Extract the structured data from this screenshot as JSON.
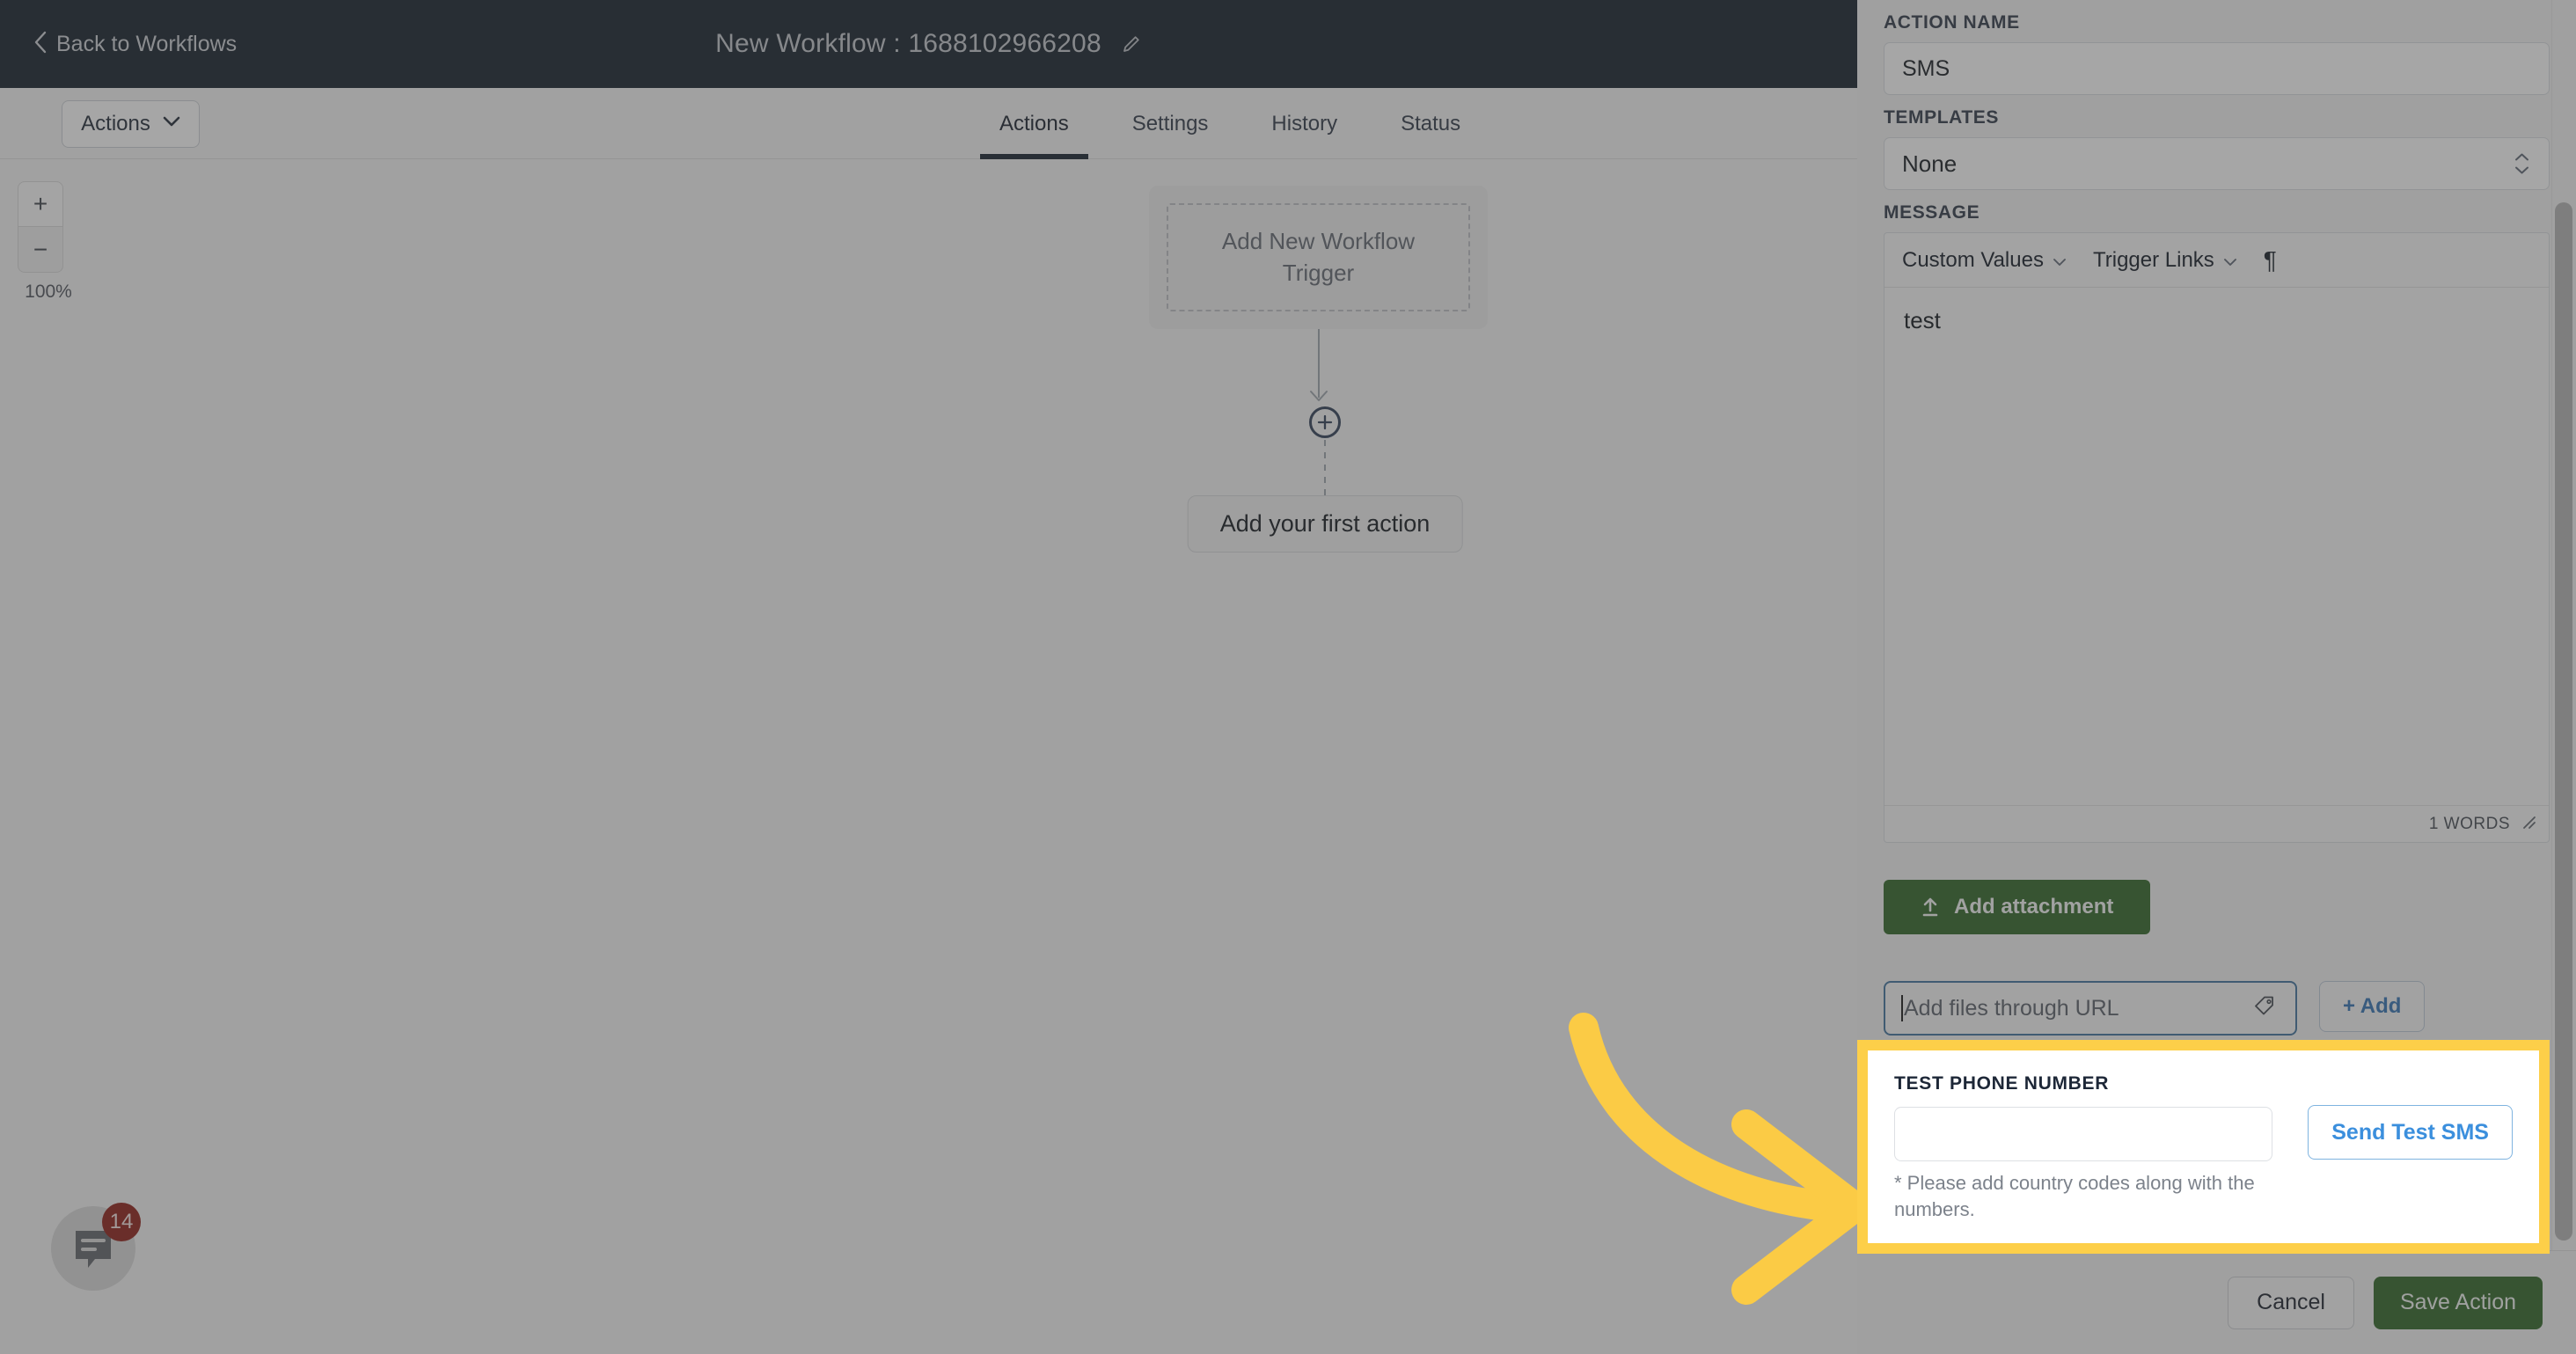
{
  "topbar": {
    "back_label": "Back to Workflows",
    "back_icon": "chevron-left-icon",
    "workflow_title": "New Workflow : 1688102966208",
    "edit_icon": "pencil-icon"
  },
  "tabbar": {
    "actions_dropdown_label": "Actions",
    "dropdown_icon": "chevron-down-icon",
    "tabs": [
      {
        "label": "Actions",
        "active": true
      },
      {
        "label": "Settings",
        "active": false
      },
      {
        "label": "History",
        "active": false
      },
      {
        "label": "Status",
        "active": false
      }
    ]
  },
  "canvas": {
    "zoom_in_label": "+",
    "zoom_out_label": "−",
    "zoom_level": "100%",
    "trigger_card_label": "Add New Workflow Trigger",
    "add_node_icon": "plus-circle-icon",
    "first_action_label": "Add your first action"
  },
  "chat_widget": {
    "icon": "chat-bubble-icon",
    "badge_count": "14"
  },
  "panel": {
    "action_name": {
      "label": "ACTION NAME",
      "value": "SMS"
    },
    "templates": {
      "label": "TEMPLATES",
      "value": "None",
      "caret_icon": "chevron-updown-icon"
    },
    "message": {
      "label": "MESSAGE",
      "toolbar": [
        {
          "label": "Custom Values",
          "icon": "chevron-down-icon"
        },
        {
          "label": "Trigger Links",
          "icon": "chevron-down-icon"
        }
      ],
      "paragraph_icon": "pilcrow-icon",
      "body": "test",
      "word_count": "1 WORDS",
      "resize_icon": "resize-grip-icon"
    },
    "attachment": {
      "button_label": "Add attachment",
      "upload_icon": "upload-icon",
      "url_placeholder": "Add files through URL",
      "url_value": "",
      "tag_icon": "tag-icon",
      "add_button_label": "+ Add"
    },
    "test_phone": {
      "label": "TEST PHONE NUMBER",
      "value": "",
      "hint": "* Please add country codes along with the numbers.",
      "send_button_label": "Send Test SMS"
    },
    "footer": {
      "cancel_label": "Cancel",
      "save_label": "Save Action"
    },
    "scrollbar_icon": "vertical-scrollbar"
  },
  "annotation": {
    "arrow_icon": "curved-arrow-right-icon",
    "highlight_color": "#fdcf49"
  },
  "colors": {
    "topbar_bg": "#0f1a24",
    "accent_green": "#2a6120",
    "accent_blue": "#3b8fdd",
    "highlight_yellow": "#fdcf49",
    "badge_red": "#8b1a12"
  }
}
